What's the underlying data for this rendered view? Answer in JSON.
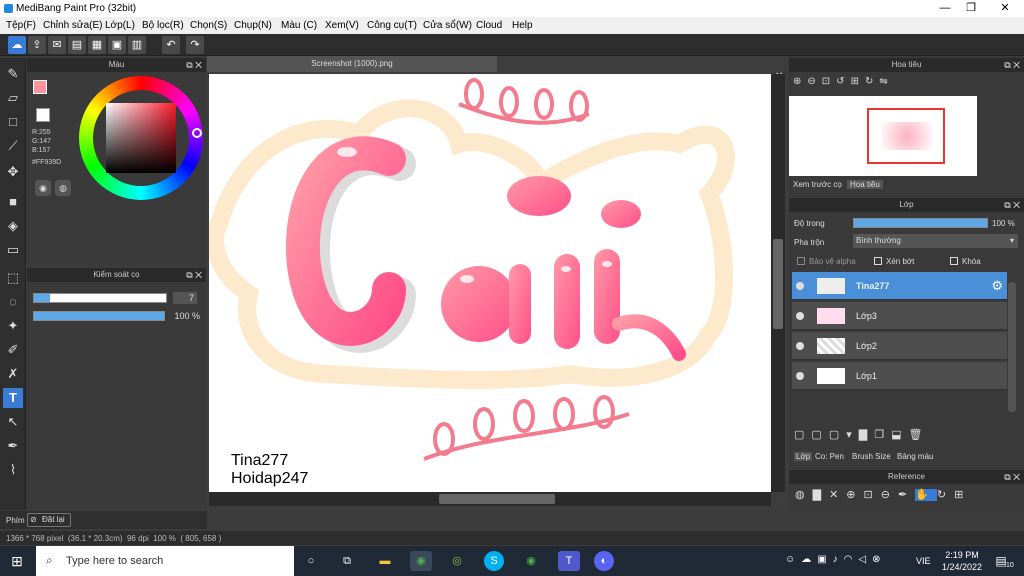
{
  "app": {
    "title": "MediBang Paint Pro (32bit)"
  },
  "window_controls": {
    "minimize": "—",
    "maximize": "❐",
    "close": "✕"
  },
  "menu": [
    "Tệp(F)",
    "Chỉnh sửa(E)",
    "Lớp(L)",
    "Bộ lọc(R)",
    "Chọn(S)",
    "Chụp(N)",
    "Màu (C)",
    "Xem(V)",
    "Công cụ(T)",
    "Cửa sổ(W)",
    "Cloud",
    "Help"
  ],
  "color_panel": {
    "title": "Màu",
    "r": "R:255",
    "g": "G:147",
    "b": "B:157",
    "hex": "#FF939D",
    "primary_color": "#ff939d",
    "secondary_color": "#ffffff"
  },
  "brush_control": {
    "title": "Kiểm soát cọ",
    "size_value": "7",
    "opacity_value": "100 %",
    "size_fraction": 0.08,
    "opacity_fraction": 1.0
  },
  "canvas": {
    "tab_title": "Screenshot (1000).png",
    "watermark_line1": "Tina277",
    "watermark_line2": "Hoidap247"
  },
  "navigator": {
    "title": "Hoa tiêu",
    "tabs": [
      "Xem trước cọ",
      "Hoa tiêu"
    ]
  },
  "layers_panel": {
    "title": "Lớp",
    "opacity_label": "Độ trong",
    "opacity_value": "100 %",
    "blend_label": "Pha trộn",
    "blend_value": "Bình thường",
    "protect_alpha": "Bảo vệ alpha",
    "clipping": "Xén bớt",
    "lock": "Khóa",
    "layers": [
      {
        "name": "Tina277",
        "selected": true
      },
      {
        "name": "Lớp3",
        "selected": false
      },
      {
        "name": "Lớp2",
        "selected": false
      },
      {
        "name": "Lớp1",
        "selected": false
      }
    ],
    "bottom_tabs": [
      "Lớp",
      "Co: Pen",
      "Brush Size",
      "Bảng màu"
    ]
  },
  "reference": {
    "title": "Reference"
  },
  "status": {
    "text": "1366 * 768 pixel  (36.1 * 20.3cm)  96 dpi  100 %  ( 805, 658 )",
    "left_tab": "Phím",
    "reset": "Đặt lại"
  },
  "taskbar": {
    "search_placeholder": "Type here to search",
    "time": "2:19 PM",
    "date": "1/24/2022",
    "lang": "VIE",
    "notif_count": "10"
  }
}
